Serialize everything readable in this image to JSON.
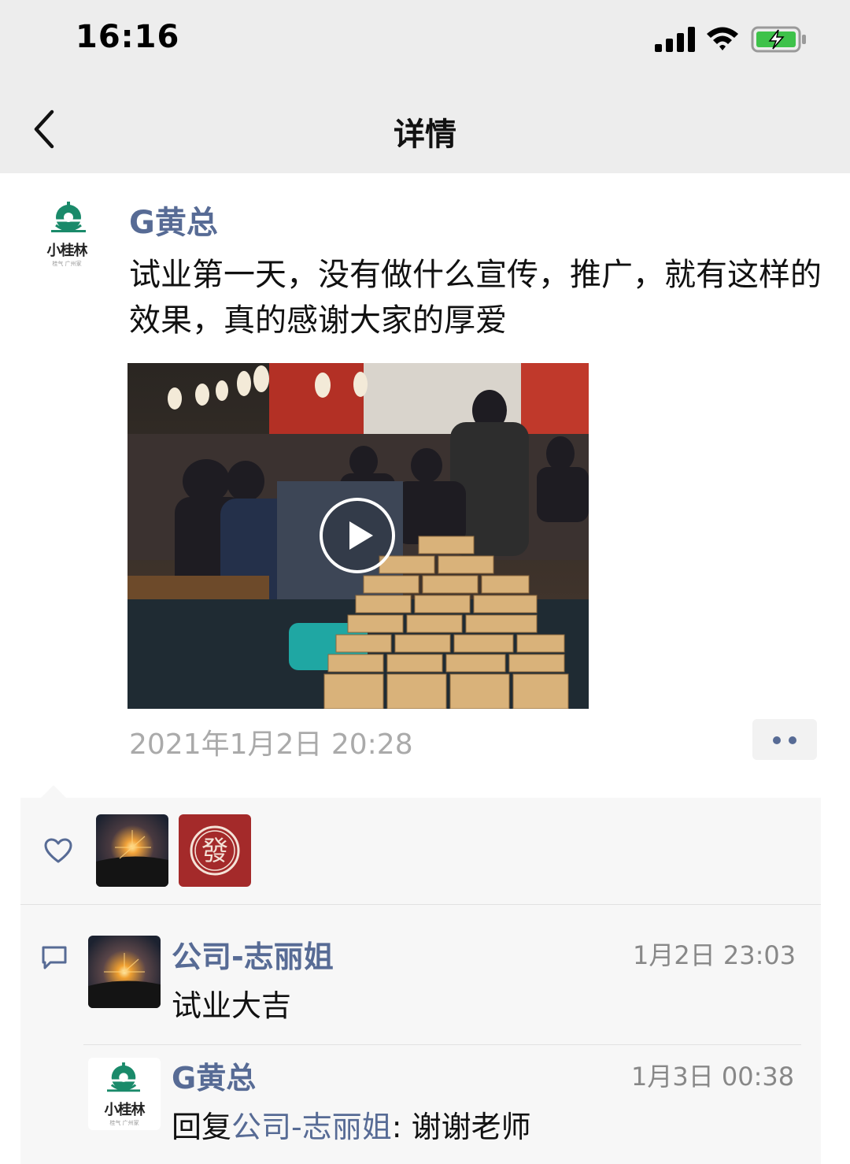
{
  "status_bar": {
    "time": "16:16"
  },
  "nav": {
    "title": "详情"
  },
  "post": {
    "author": "G黄总",
    "avatar_brand": "小桂林",
    "avatar_brand_sub": "桂气 广州家",
    "text": "试业第一天，没有做什么宣传，推广，就有这样的效果，真的感谢大家的厚爱",
    "timestamp": "2021年1月2日 20:28"
  },
  "likes": {
    "avatars": [
      "sunset-avatar",
      "fa-character-avatar"
    ],
    "fa_glyph": "發"
  },
  "comments": [
    {
      "author": "公司-志丽姐",
      "time": "1月2日 23:03",
      "text": "试业大吉"
    },
    {
      "author": "G黄总",
      "time": "1月3日 00:38",
      "reply_prefix": "回复",
      "reply_to": "公司-志丽姐",
      "reply_sep": ": ",
      "text": "谢谢老师"
    }
  ],
  "colors": {
    "link": "#576b95",
    "nav_bg": "#ededed",
    "panel_bg": "#f7f7f7",
    "brand_green": "#1a8a6a"
  }
}
